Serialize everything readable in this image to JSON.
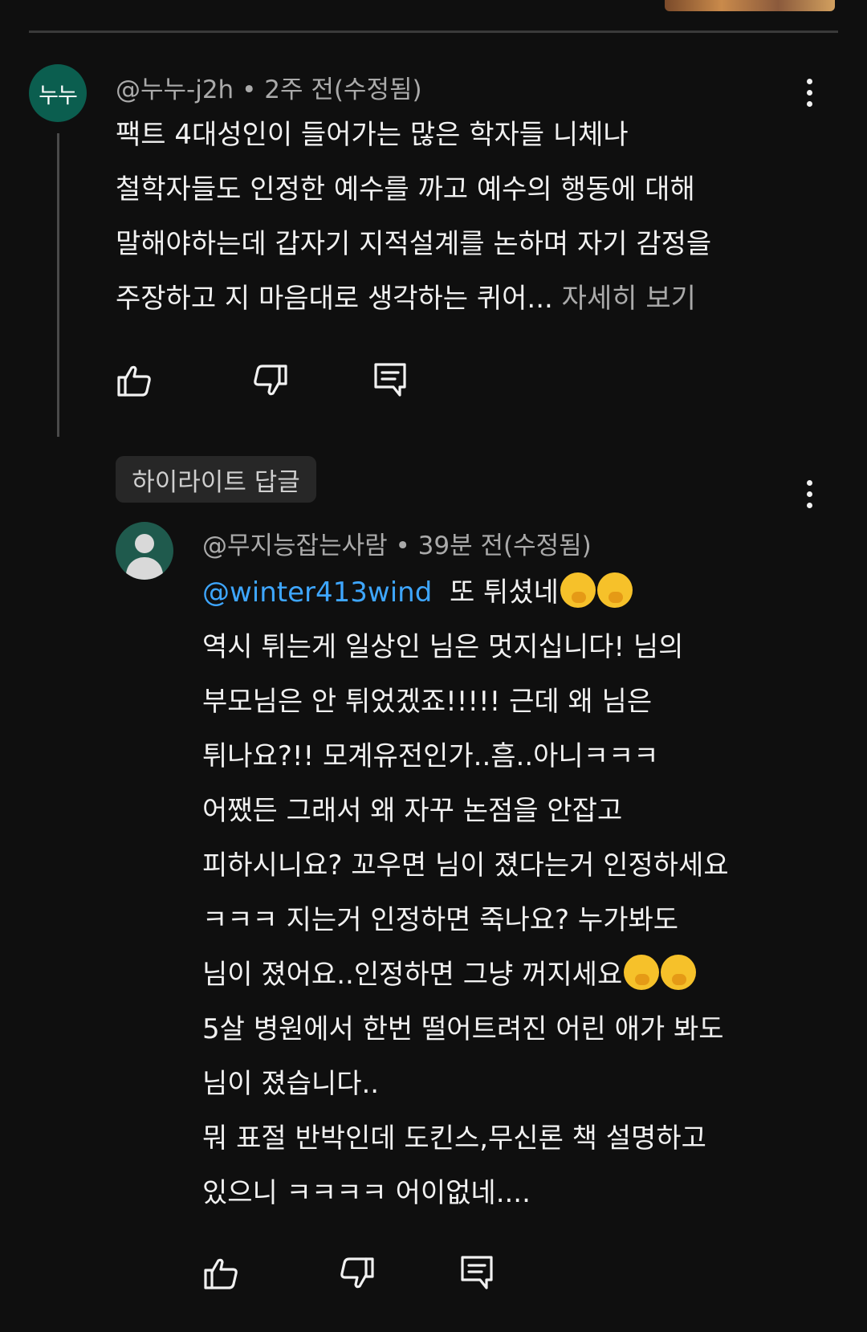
{
  "comment": {
    "avatar_text": "누누",
    "author": "@누누-j2h",
    "time": "2주 전(수정됨)",
    "lines": [
      "팩트 4대성인이 들어가는 많은 학자들 니체나",
      "철학자들도 인정한 예수를 까고 예수의 행동에 대해",
      "말해야하는데 갑자기 지적설계를 논하며 자기 감정을",
      "주장하고 지 마음대로 생각하는 퀴어..."
    ],
    "more_label": "자세히 보기"
  },
  "highlight_label": "하이라이트 답글",
  "reply": {
    "author": "@무지능잡는사람",
    "time": "39분 전(수정됨)",
    "mention": "@winter413wind",
    "first_line_rest": "또 튀셨네",
    "lines": [
      "역시 튀는게 일상인 님은 멋지십니다! 님의",
      "부모님은 안 튀었겠죠!!!!! 근데 왜 님은",
      "튀나요?!! 모계유전인가..흠..아니ㅋㅋㅋ",
      "어쨌든 그래서 왜 자꾸 논점을 안잡고",
      "피하시니요? 꼬우면 님이 졌다는거 인정하세요",
      "ㅋㅋㅋ 지는거 인정하면 죽나요? 누가봐도",
      "님이 졌어요..인정하면 그냥 꺼지세요",
      "5살 병원에서 한번 떨어트려진 어린 애가 봐도",
      "님이 졌습니다..",
      "뭐 표절 반박인데 도킨스,무신론 책 설명하고",
      "있으니 ㅋㅋㅋㅋ 어이없네...."
    ]
  },
  "icons": {
    "like": "thumbs-up-icon",
    "dislike": "thumbs-down-icon",
    "reply": "comment-reply-icon",
    "more": "more-vertical-icon",
    "emoji": "hand-over-mouth-emoji"
  },
  "colors": {
    "background": "#0f0f0f",
    "text": "#f1f1f1",
    "secondary": "#aaaaaa",
    "mention": "#3ea6ff",
    "avatar": "#0b5e4f"
  }
}
